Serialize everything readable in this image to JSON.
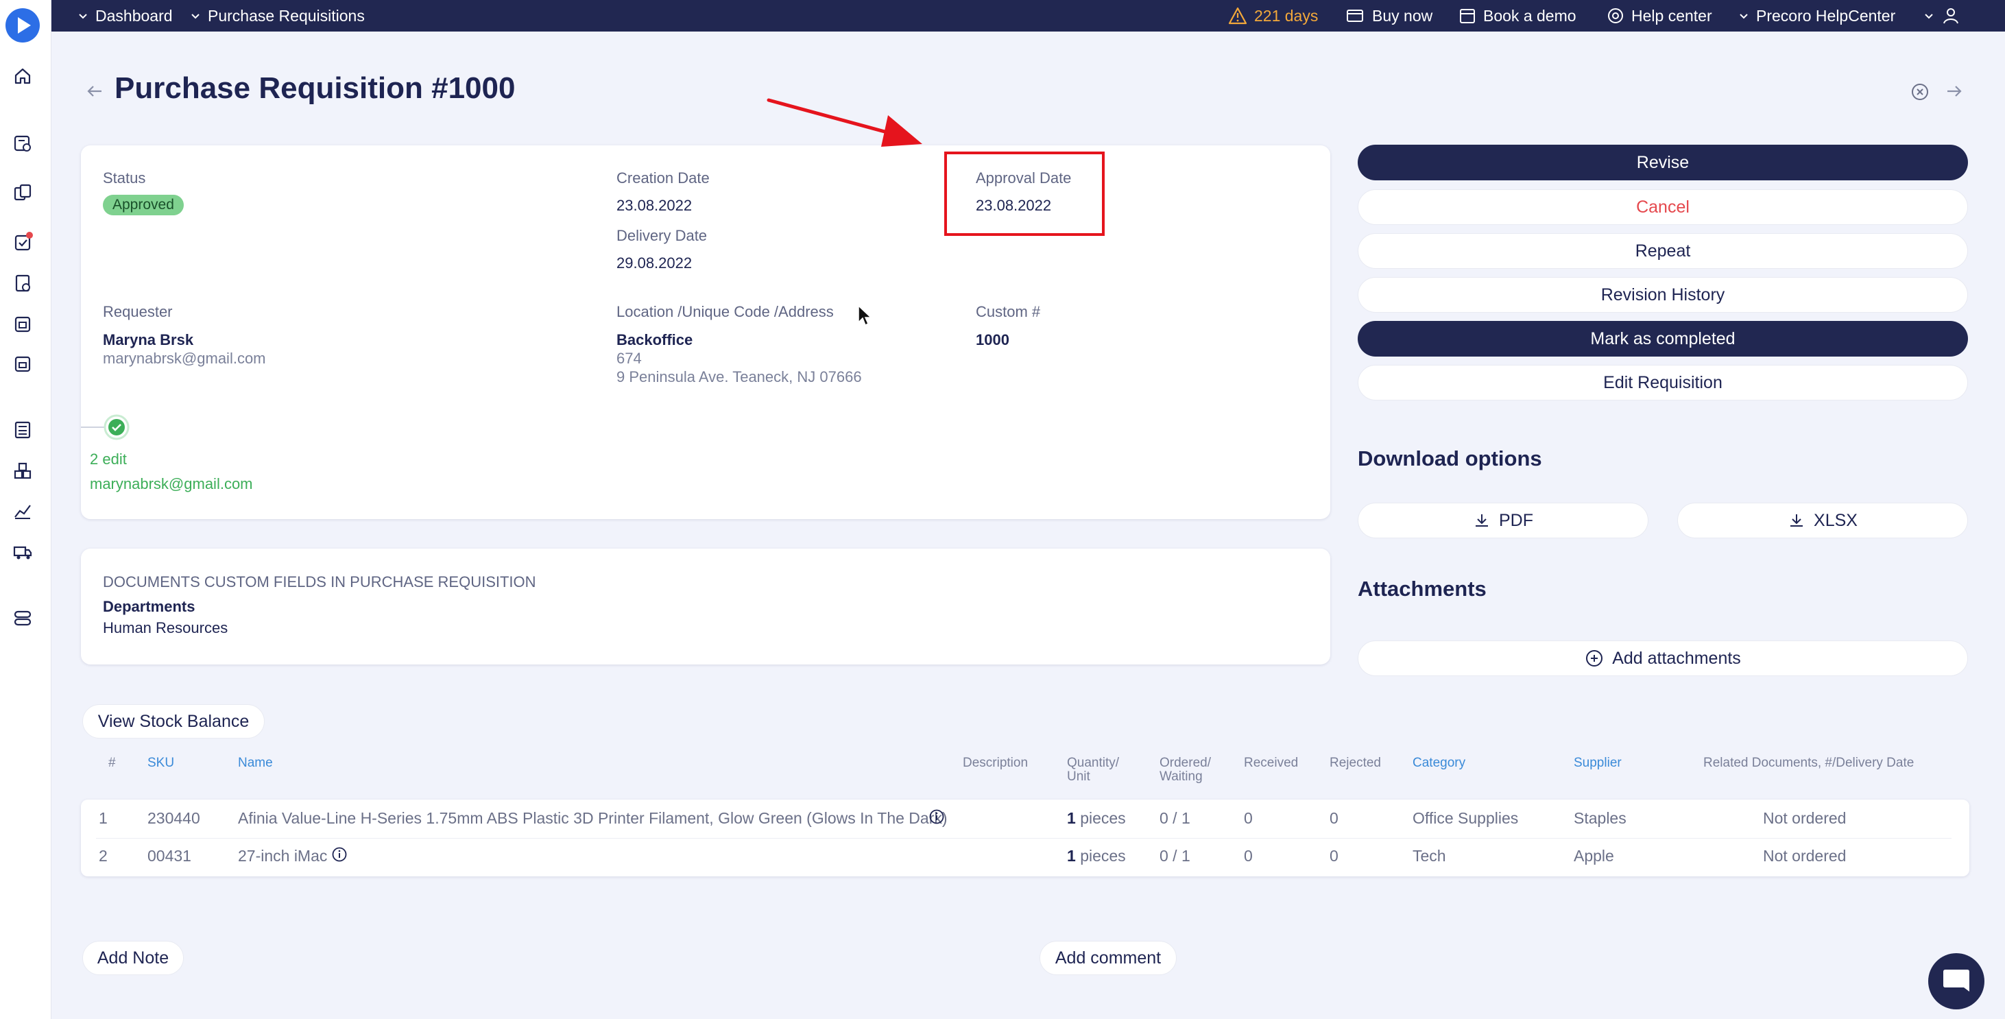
{
  "topbar": {
    "breadcrumb": [
      "Dashboard",
      "Purchase Requisitions"
    ],
    "trial_days": "221 days",
    "buy_now": "Buy now",
    "book_demo": "Book a demo",
    "help_center": "Help center",
    "company": "Precoro HelpCenter"
  },
  "page": {
    "title": "Purchase Requisition #1000"
  },
  "details": {
    "status_label": "Status",
    "status_value": "Approved",
    "creation_date_label": "Creation Date",
    "creation_date_value": "23.08.2022",
    "delivery_date_label": "Delivery Date",
    "delivery_date_value": "29.08.2022",
    "approval_date_label": "Approval Date",
    "approval_date_value": "23.08.2022",
    "requester_label": "Requester",
    "requester_name": "Maryna Brsk",
    "requester_email": "marynabrsk@gmail.com",
    "location_label": "Location /Unique Code /Address",
    "location_name": "Backoffice",
    "location_code": "674",
    "location_address": "9 Peninsula Ave. Teaneck, NJ 07666",
    "custom_label": "Custom #",
    "custom_value": "1000",
    "approval_step": "2 edit",
    "approver_email": "marynabrsk@gmail.com"
  },
  "custom_fields": {
    "heading": "DOCUMENTS CUSTOM FIELDS IN PURCHASE REQUISITION",
    "field_label": "Departments",
    "field_value": "Human Resources"
  },
  "actions": {
    "revise": "Revise",
    "cancel": "Cancel",
    "repeat": "Repeat",
    "revision_history": "Revision History",
    "mark_completed": "Mark as completed",
    "edit": "Edit Requisition"
  },
  "download": {
    "heading": "Download options",
    "pdf": "PDF",
    "xlsx": "XLSX"
  },
  "attachments": {
    "heading": "Attachments",
    "add": "Add attachments"
  },
  "stock_button": "View Stock Balance",
  "table": {
    "columns": {
      "num": "#",
      "sku": "SKU",
      "name": "Name",
      "description": "Description",
      "qty_1": "Quantity/",
      "qty_2": "Unit",
      "ordered_1": "Ordered/",
      "ordered_2": "Waiting",
      "received": "Received",
      "rejected": "Rejected",
      "category": "Category",
      "supplier": "Supplier",
      "related": "Related Documents, #/Delivery Date"
    },
    "rows": [
      {
        "num": "1",
        "sku": "230440",
        "name": "Afinia Value-Line H-Series 1.75mm ABS Plastic 3D Printer Filament, Glow Green (Glows In The Dark)",
        "qty": "1",
        "unit": "pieces",
        "ordered": "0 / 1",
        "received": "0",
        "rejected": "0",
        "category": "Office Supplies",
        "supplier": "Staples",
        "related": "Not ordered"
      },
      {
        "num": "2",
        "sku": "00431",
        "name": "27-inch iMac",
        "qty": "1",
        "unit": "pieces",
        "ordered": "0 / 1",
        "received": "0",
        "rejected": "0",
        "category": "Tech",
        "supplier": "Apple",
        "related": "Not ordered"
      }
    ]
  },
  "notes": {
    "add_note": "Add Note",
    "add_comment": "Add comment"
  },
  "colors": {
    "navy": "#212751",
    "accent_red": "#e5484d",
    "success_green": "#3cae58",
    "annotation_red": "#e5141d"
  }
}
